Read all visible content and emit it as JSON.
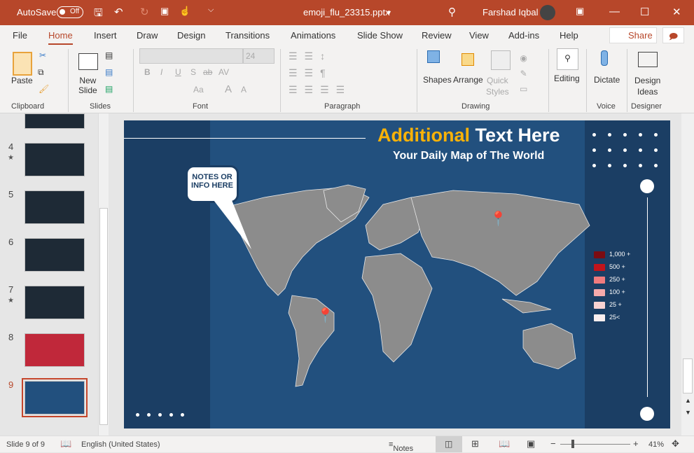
{
  "titlebar": {
    "autosave": "AutoSave",
    "toggle": "Off",
    "filename": "emoji_flu_23315.pptx",
    "user": "Farshad Iqbal"
  },
  "tabs": [
    "File",
    "Home",
    "Insert",
    "Draw",
    "Design",
    "Transitions",
    "Animations",
    "Slide Show",
    "Review",
    "View",
    "Add-ins",
    "Help"
  ],
  "share": "Share",
  "ribbon": {
    "groups": {
      "clipboard": "Clipboard",
      "slides": "Slides",
      "font": "Font",
      "paragraph": "Paragraph",
      "drawing": "Drawing",
      "voice": "Voice",
      "designer": "Designer"
    },
    "paste": "Paste",
    "new_slide": [
      "New",
      "Slide"
    ],
    "font_size": "24",
    "font_buttons": [
      "B",
      "I",
      "U",
      "S",
      "ab",
      "AV",
      "Aa",
      "A",
      "A"
    ],
    "shapes": "Shapes",
    "arrange": "Arrange",
    "quick_styles": [
      "Quick",
      "Styles"
    ],
    "editing": "Editing",
    "dictate": "Dictate",
    "design_ideas": [
      "Design",
      "Ideas"
    ]
  },
  "thumbnails": [
    {
      "num": "4",
      "star": true
    },
    {
      "num": "5",
      "star": false
    },
    {
      "num": "6",
      "star": false
    },
    {
      "num": "7",
      "star": true
    },
    {
      "num": "8",
      "star": false
    },
    {
      "num": "9",
      "star": false,
      "active": true
    }
  ],
  "slide": {
    "title_accent": "Additional",
    "title_rest": " Text Here",
    "subtitle": "Your Daily Map of The World",
    "callout": [
      "NOTES OR",
      "INFO HERE"
    ],
    "legend": [
      {
        "label": "1,000 +",
        "color": "#7b0c12"
      },
      {
        "label": "500 +",
        "color": "#c0141c"
      },
      {
        "label": "250 +",
        "color": "#f07b7e"
      },
      {
        "label": "100 +",
        "color": "#f5a9ab"
      },
      {
        "label": "25 +",
        "color": "#f8d2d3"
      },
      {
        "label": "25<",
        "color": "#fbeeee"
      }
    ],
    "colors": {
      "accent": "#f9b208",
      "background": "#22507e",
      "strip": "#1b3e64",
      "land": "#8c8c8c"
    }
  },
  "status": {
    "slide": "Slide 9 of 9",
    "language": "English (United States)",
    "notes": "Notes",
    "zoom": "41%"
  }
}
